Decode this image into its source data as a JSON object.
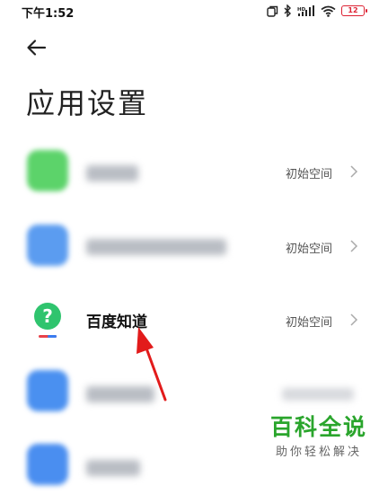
{
  "status_bar": {
    "time": "下午1:52",
    "battery": "12",
    "icons": [
      "dual-window-icon",
      "bluetooth-icon",
      "hd-signal-icon",
      "wifi-icon",
      "battery-icon"
    ]
  },
  "header": {
    "back_icon": "back-arrow-icon",
    "title": "应用设置"
  },
  "apps": [
    {
      "name": "",
      "value": "初始空间",
      "icon_color": "#5cd36a",
      "blurred": true
    },
    {
      "name": "",
      "value": "初始空间",
      "icon_color": "#5b9cf0",
      "blurred": true
    },
    {
      "name": "百度知道",
      "value": "初始空间",
      "icon_color": "#2fc46e",
      "blurred": false
    },
    {
      "name": "",
      "value": "",
      "icon_color": "#4a90f0",
      "blurred": true
    },
    {
      "name": "",
      "value": "",
      "icon_color": "#4a8ef0",
      "blurred": true
    }
  ],
  "annotation": {
    "color": "#e21b1b"
  },
  "watermark": {
    "title": "百科全说",
    "subtitle": "助你轻松解决",
    "color": "#2aa52c"
  }
}
